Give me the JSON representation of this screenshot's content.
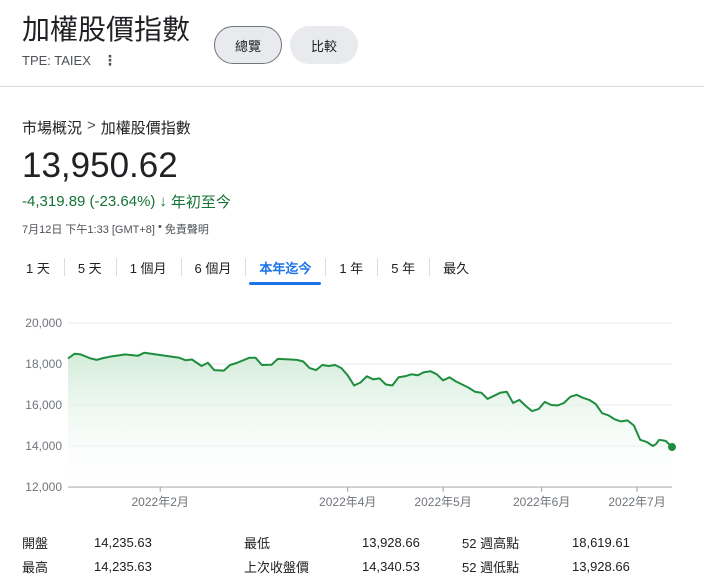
{
  "header": {
    "title": "加權股價指數",
    "ticker": "TPE: TAIEX",
    "more_glyph": "⋮",
    "buttons": {
      "overview": "總覽",
      "compare": "比較"
    }
  },
  "breadcrumb": {
    "root": "市場概況",
    "separator": ">",
    "current": "加權股價指數"
  },
  "quote": {
    "price": "13,950.62",
    "change": "-4,319.89 (-23.64%)",
    "change_arrow": "↓",
    "change_period": "年初至今",
    "timestamp": "7月12日 下午1:33 [GMT+8]",
    "dot": "•",
    "disclaimer": "免責聲明"
  },
  "range_tabs": [
    "1 天",
    "5 天",
    "1 個月",
    "6 個月",
    "本年迄今",
    "1 年",
    "5 年",
    "最久"
  ],
  "active_range": "本年迄今",
  "colors": {
    "line": "#1e8e3e",
    "fill_top": "#ceead6",
    "grid": "#e8eaed",
    "accent": "#1a73e8"
  },
  "chart_data": {
    "type": "area",
    "ylim": [
      12000,
      20000
    ],
    "y_ticks": [
      12000,
      14000,
      16000,
      18000,
      20000
    ],
    "y_tick_labels": [
      "12,000",
      "14,000",
      "16,000",
      "18,000",
      "20,000"
    ],
    "x_range": [
      "2022-01-03",
      "2022-07-12"
    ],
    "x_ticks": [
      {
        "date": "2022-02-01",
        "label": "2022年2月"
      },
      {
        "date": "2022-04-01",
        "label": "2022年4月"
      },
      {
        "date": "2022-05-01",
        "label": "2022年5月"
      },
      {
        "date": "2022-06-01",
        "label": "2022年6月"
      },
      {
        "date": "2022-07-01",
        "label": "2022年7月"
      }
    ],
    "series": [
      {
        "points": [
          [
            "2022-01-03",
            18270
          ],
          [
            "2022-01-05",
            18500
          ],
          [
            "2022-01-07",
            18470
          ],
          [
            "2022-01-10",
            18280
          ],
          [
            "2022-01-12",
            18200
          ],
          [
            "2022-01-14",
            18290
          ],
          [
            "2022-01-17",
            18380
          ],
          [
            "2022-01-19",
            18420
          ],
          [
            "2022-01-21",
            18470
          ],
          [
            "2022-01-25",
            18400
          ],
          [
            "2022-01-27",
            18550
          ],
          [
            "2022-02-07",
            18300
          ],
          [
            "2022-02-09",
            18180
          ],
          [
            "2022-02-11",
            18220
          ],
          [
            "2022-02-14",
            17900
          ],
          [
            "2022-02-16",
            18060
          ],
          [
            "2022-02-18",
            17700
          ],
          [
            "2022-02-21",
            17680
          ],
          [
            "2022-02-23",
            17950
          ],
          [
            "2022-02-25",
            18050
          ],
          [
            "2022-03-01",
            18300
          ],
          [
            "2022-03-03",
            18300
          ],
          [
            "2022-03-05",
            17950
          ],
          [
            "2022-03-08",
            17960
          ],
          [
            "2022-03-10",
            18250
          ],
          [
            "2022-03-14",
            18220
          ],
          [
            "2022-03-16",
            18200
          ],
          [
            "2022-03-18",
            18120
          ],
          [
            "2022-03-20",
            17800
          ],
          [
            "2022-03-22",
            17700
          ],
          [
            "2022-03-24",
            17950
          ],
          [
            "2022-03-26",
            17900
          ],
          [
            "2022-03-28",
            17950
          ],
          [
            "2022-03-30",
            17800
          ],
          [
            "2022-04-01",
            17450
          ],
          [
            "2022-04-03",
            16950
          ],
          [
            "2022-04-05",
            17100
          ],
          [
            "2022-04-07",
            17400
          ],
          [
            "2022-04-09",
            17250
          ],
          [
            "2022-04-11",
            17300
          ],
          [
            "2022-04-13",
            17000
          ],
          [
            "2022-04-15",
            16950
          ],
          [
            "2022-04-17",
            17350
          ],
          [
            "2022-04-19",
            17400
          ],
          [
            "2022-04-21",
            17500
          ],
          [
            "2022-04-23",
            17450
          ],
          [
            "2022-04-25",
            17600
          ],
          [
            "2022-04-27",
            17650
          ],
          [
            "2022-04-29",
            17500
          ],
          [
            "2022-05-01",
            17200
          ],
          [
            "2022-05-03",
            17350
          ],
          [
            "2022-05-05",
            17150
          ],
          [
            "2022-05-07",
            17000
          ],
          [
            "2022-05-09",
            16850
          ],
          [
            "2022-05-11",
            16650
          ],
          [
            "2022-05-13",
            16600
          ],
          [
            "2022-05-15",
            16300
          ],
          [
            "2022-05-17",
            16450
          ],
          [
            "2022-05-19",
            16600
          ],
          [
            "2022-05-21",
            16650
          ],
          [
            "2022-05-23",
            16100
          ],
          [
            "2022-05-25",
            16250
          ],
          [
            "2022-05-27",
            15950
          ],
          [
            "2022-05-29",
            15700
          ],
          [
            "2022-05-31",
            15800
          ],
          [
            "2022-06-02",
            16150
          ],
          [
            "2022-06-04",
            16000
          ],
          [
            "2022-06-06",
            15980
          ],
          [
            "2022-06-08",
            16100
          ],
          [
            "2022-06-10",
            16400
          ],
          [
            "2022-06-12",
            16500
          ],
          [
            "2022-06-14",
            16350
          ],
          [
            "2022-06-16",
            16250
          ],
          [
            "2022-06-18",
            16050
          ],
          [
            "2022-06-20",
            15600
          ],
          [
            "2022-06-22",
            15500
          ],
          [
            "2022-06-24",
            15300
          ],
          [
            "2022-06-26",
            15200
          ],
          [
            "2022-06-28",
            15250
          ],
          [
            "2022-06-30",
            15000
          ],
          [
            "2022-07-02",
            14300
          ],
          [
            "2022-07-04",
            14200
          ],
          [
            "2022-07-06",
            14000
          ],
          [
            "2022-07-07",
            14100
          ],
          [
            "2022-07-08",
            14300
          ],
          [
            "2022-07-10",
            14250
          ],
          [
            "2022-07-12",
            13950
          ]
        ]
      }
    ]
  },
  "stats": [
    [
      {
        "label": "開盤",
        "value": "14,235.63"
      },
      {
        "label": "最低",
        "value": "13,928.66"
      },
      {
        "label": "52 週高點",
        "value": "18,619.61"
      }
    ],
    [
      {
        "label": "最高",
        "value": "14,235.63"
      },
      {
        "label": "上次收盤價",
        "value": "14,340.53"
      },
      {
        "label": "52 週低點",
        "value": "13,928.66"
      }
    ]
  ]
}
